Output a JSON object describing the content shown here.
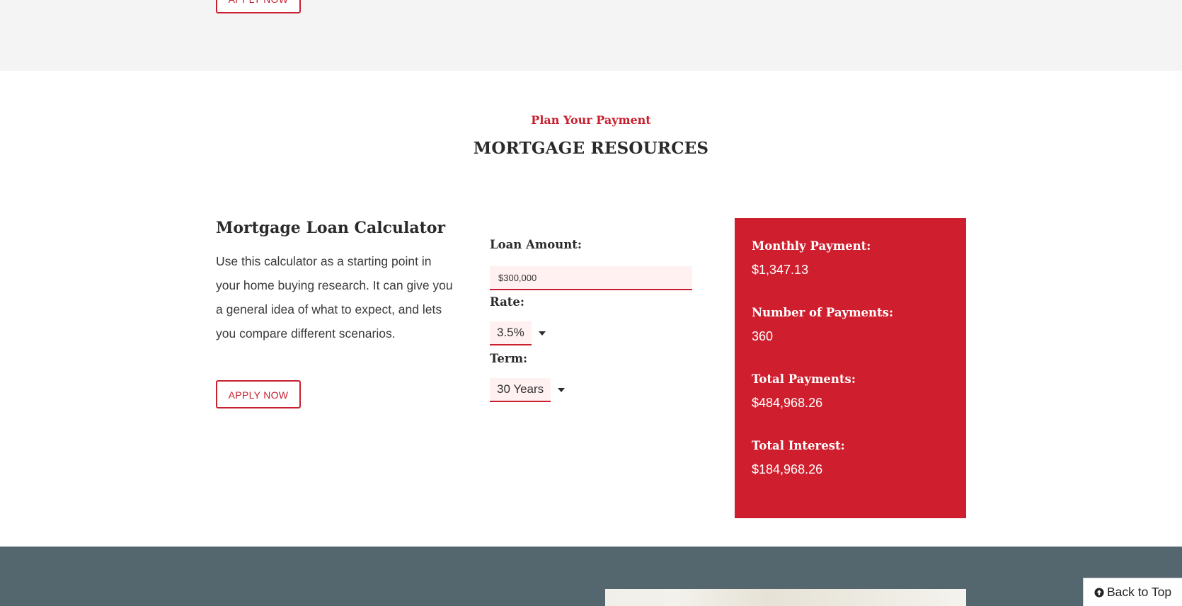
{
  "top": {
    "apply_label": "APPLY NOW"
  },
  "section": {
    "eyebrow": "Plan Your Payment",
    "title": "MORTGAGE RESOURCES"
  },
  "calculator": {
    "title": "Mortgage Loan Calculator",
    "description": "Use this calculator as a starting point in your home buying research. It can give you a general idea of what to expect, and lets you compare different scenarios.",
    "apply_label": "APPLY NOW",
    "loan_amount_label": "Loan Amount:",
    "loan_amount_value": "$300,000",
    "rate_label": "Rate:",
    "rate_value": "3.5%",
    "term_label": "Term:",
    "term_value": "30 Years"
  },
  "results": {
    "monthly_payment_label": "Monthly Payment:",
    "monthly_payment_value": "$1,347.13",
    "number_of_payments_label": "Number of Payments:",
    "number_of_payments_value": "360",
    "total_payments_label": "Total Payments:",
    "total_payments_value": "$484,968.26",
    "total_interest_label": "Total Interest:",
    "total_interest_value": "$184,968.26"
  },
  "footer": {
    "back_to_top_label": "Back to Top",
    "back_to_top_icon": "arrow-circle-up-icon"
  },
  "colors": {
    "brand_red": "#cf1f2e",
    "slate_band": "#54676e",
    "light_band": "#f4f4f4"
  }
}
